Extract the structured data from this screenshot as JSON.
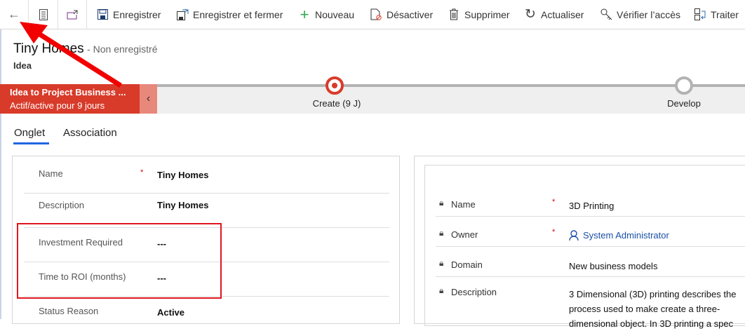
{
  "toolbar": {
    "items": [
      {
        "label": "Enregistrer",
        "icon": "save-icon"
      },
      {
        "label": "Enregistrer et fermer",
        "icon": "save-close-icon"
      },
      {
        "label": "Nouveau",
        "icon": "plus-icon"
      },
      {
        "label": "Désactiver",
        "icon": "deactivate-icon"
      },
      {
        "label": "Supprimer",
        "icon": "trash-icon"
      },
      {
        "label": "Actualiser",
        "icon": "refresh-icon"
      },
      {
        "label": "Vérifier l’accès",
        "icon": "key-icon"
      },
      {
        "label": "Traiter",
        "icon": "process-icon"
      }
    ]
  },
  "header": {
    "title": "Tiny Homes",
    "status": "- Non enregistré",
    "entity": "Idea"
  },
  "bpf": {
    "name": "Idea to Project Business ...",
    "duration": "Actif/active pour 9 jours",
    "stages": [
      {
        "label": "Create  (9 J)",
        "active": true
      },
      {
        "label": "Develop",
        "active": false
      }
    ],
    "accent": "#d83b2a"
  },
  "tabs": [
    {
      "label": "Onglet",
      "selected": true
    },
    {
      "label": "Association",
      "selected": false
    }
  ],
  "left_form": {
    "fields": [
      {
        "label": "Name",
        "value": "Tiny Homes",
        "required": "*"
      },
      {
        "label": "Description",
        "value": "Tiny Homes"
      },
      {
        "label": "Investment Required",
        "value": "---"
      },
      {
        "label": "Time to ROI (months)",
        "value": "---"
      },
      {
        "label": "Status Reason",
        "value": "Active"
      }
    ]
  },
  "right_form": {
    "fields": [
      {
        "label": "Name",
        "value": "3D Printing",
        "required": "*"
      },
      {
        "label": "Owner",
        "value": "System Administrator",
        "required": "*"
      },
      {
        "label": "Domain",
        "value": "New business models"
      },
      {
        "label": "Description",
        "lines": [
          "3 Dimensional (3D) printing describes the",
          "process used to make create a three-",
          "dimensional object. In 3D printing a spec"
        ]
      }
    ]
  }
}
